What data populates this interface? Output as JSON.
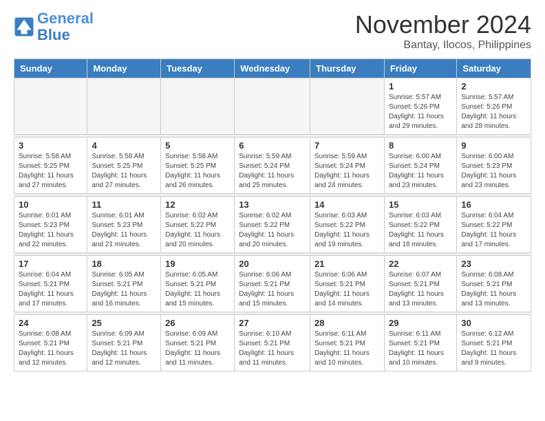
{
  "header": {
    "logo_line1": "General",
    "logo_line2": "Blue",
    "month": "November 2024",
    "location": "Bantay, Ilocos, Philippines"
  },
  "weekdays": [
    "Sunday",
    "Monday",
    "Tuesday",
    "Wednesday",
    "Thursday",
    "Friday",
    "Saturday"
  ],
  "weeks": [
    [
      {
        "day": "",
        "info": ""
      },
      {
        "day": "",
        "info": ""
      },
      {
        "day": "",
        "info": ""
      },
      {
        "day": "",
        "info": ""
      },
      {
        "day": "",
        "info": ""
      },
      {
        "day": "1",
        "info": "Sunrise: 5:57 AM\nSunset: 5:26 PM\nDaylight: 11 hours\nand 29 minutes."
      },
      {
        "day": "2",
        "info": "Sunrise: 5:57 AM\nSunset: 5:26 PM\nDaylight: 11 hours\nand 28 minutes."
      }
    ],
    [
      {
        "day": "3",
        "info": "Sunrise: 5:58 AM\nSunset: 5:25 PM\nDaylight: 11 hours\nand 27 minutes."
      },
      {
        "day": "4",
        "info": "Sunrise: 5:58 AM\nSunset: 5:25 PM\nDaylight: 11 hours\nand 27 minutes."
      },
      {
        "day": "5",
        "info": "Sunrise: 5:58 AM\nSunset: 5:25 PM\nDaylight: 11 hours\nand 26 minutes."
      },
      {
        "day": "6",
        "info": "Sunrise: 5:59 AM\nSunset: 5:24 PM\nDaylight: 11 hours\nand 25 minutes."
      },
      {
        "day": "7",
        "info": "Sunrise: 5:59 AM\nSunset: 5:24 PM\nDaylight: 11 hours\nand 24 minutes."
      },
      {
        "day": "8",
        "info": "Sunrise: 6:00 AM\nSunset: 5:24 PM\nDaylight: 11 hours\nand 23 minutes."
      },
      {
        "day": "9",
        "info": "Sunrise: 6:00 AM\nSunset: 5:23 PM\nDaylight: 11 hours\nand 23 minutes."
      }
    ],
    [
      {
        "day": "10",
        "info": "Sunrise: 6:01 AM\nSunset: 5:23 PM\nDaylight: 11 hours\nand 22 minutes."
      },
      {
        "day": "11",
        "info": "Sunrise: 6:01 AM\nSunset: 5:23 PM\nDaylight: 11 hours\nand 21 minutes."
      },
      {
        "day": "12",
        "info": "Sunrise: 6:02 AM\nSunset: 5:22 PM\nDaylight: 11 hours\nand 20 minutes."
      },
      {
        "day": "13",
        "info": "Sunrise: 6:02 AM\nSunset: 5:22 PM\nDaylight: 11 hours\nand 20 minutes."
      },
      {
        "day": "14",
        "info": "Sunrise: 6:03 AM\nSunset: 5:22 PM\nDaylight: 11 hours\nand 19 minutes."
      },
      {
        "day": "15",
        "info": "Sunrise: 6:03 AM\nSunset: 5:22 PM\nDaylight: 11 hours\nand 18 minutes."
      },
      {
        "day": "16",
        "info": "Sunrise: 6:04 AM\nSunset: 5:22 PM\nDaylight: 11 hours\nand 17 minutes."
      }
    ],
    [
      {
        "day": "17",
        "info": "Sunrise: 6:04 AM\nSunset: 5:21 PM\nDaylight: 11 hours\nand 17 minutes."
      },
      {
        "day": "18",
        "info": "Sunrise: 6:05 AM\nSunset: 5:21 PM\nDaylight: 11 hours\nand 16 minutes."
      },
      {
        "day": "19",
        "info": "Sunrise: 6:05 AM\nSunset: 5:21 PM\nDaylight: 11 hours\nand 15 minutes."
      },
      {
        "day": "20",
        "info": "Sunrise: 6:06 AM\nSunset: 5:21 PM\nDaylight: 11 hours\nand 15 minutes."
      },
      {
        "day": "21",
        "info": "Sunrise: 6:06 AM\nSunset: 5:21 PM\nDaylight: 11 hours\nand 14 minutes."
      },
      {
        "day": "22",
        "info": "Sunrise: 6:07 AM\nSunset: 5:21 PM\nDaylight: 11 hours\nand 13 minutes."
      },
      {
        "day": "23",
        "info": "Sunrise: 6:08 AM\nSunset: 5:21 PM\nDaylight: 11 hours\nand 13 minutes."
      }
    ],
    [
      {
        "day": "24",
        "info": "Sunrise: 6:08 AM\nSunset: 5:21 PM\nDaylight: 11 hours\nand 12 minutes."
      },
      {
        "day": "25",
        "info": "Sunrise: 6:09 AM\nSunset: 5:21 PM\nDaylight: 11 hours\nand 12 minutes."
      },
      {
        "day": "26",
        "info": "Sunrise: 6:09 AM\nSunset: 5:21 PM\nDaylight: 11 hours\nand 11 minutes."
      },
      {
        "day": "27",
        "info": "Sunrise: 6:10 AM\nSunset: 5:21 PM\nDaylight: 11 hours\nand 11 minutes."
      },
      {
        "day": "28",
        "info": "Sunrise: 6:11 AM\nSunset: 5:21 PM\nDaylight: 11 hours\nand 10 minutes."
      },
      {
        "day": "29",
        "info": "Sunrise: 6:11 AM\nSunset: 5:21 PM\nDaylight: 11 hours\nand 10 minutes."
      },
      {
        "day": "30",
        "info": "Sunrise: 6:12 AM\nSunset: 5:21 PM\nDaylight: 11 hours\nand 9 minutes."
      }
    ]
  ]
}
